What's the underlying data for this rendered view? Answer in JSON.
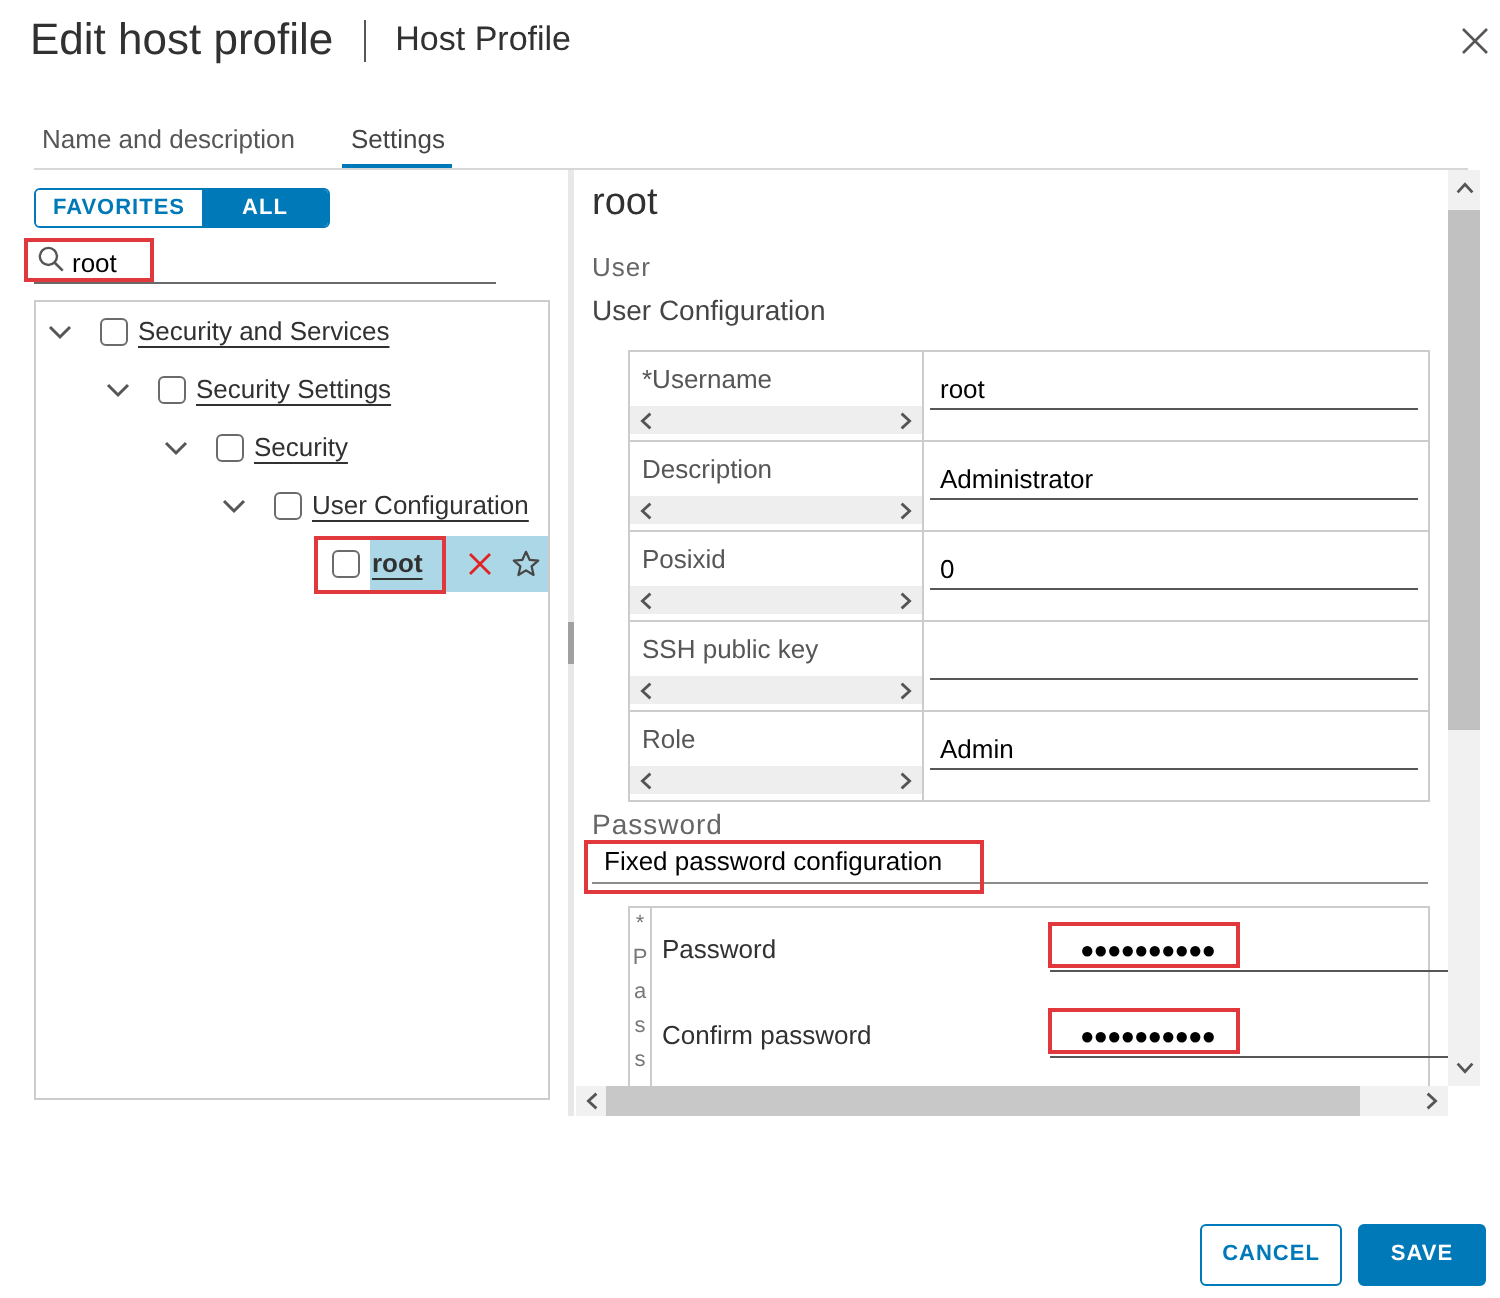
{
  "dialog": {
    "title": "Edit host profile",
    "subtitle": "Host Profile"
  },
  "tabs": [
    {
      "label": "Name and description",
      "selected": false
    },
    {
      "label": "Settings",
      "selected": true
    }
  ],
  "filter_toggle": [
    {
      "label": "FAVORITES",
      "selected": false
    },
    {
      "label": "ALL",
      "selected": true
    }
  ],
  "search": {
    "value": "root",
    "annotated": true
  },
  "tree": [
    {
      "label": "Security and Services",
      "checked": false,
      "expanded": true,
      "selected": false,
      "annotated": false,
      "children": [
        {
          "label": "Security Settings",
          "checked": false,
          "expanded": true,
          "selected": false,
          "annotated": false,
          "children": [
            {
              "label": "Security",
              "checked": false,
              "expanded": true,
              "selected": false,
              "annotated": false,
              "children": [
                {
                  "label": "User Configuration",
                  "checked": false,
                  "expanded": true,
                  "selected": false,
                  "annotated": false,
                  "children": [
                    {
                      "label": "root",
                      "checked": false,
                      "selected": true,
                      "annotated": true
                    }
                  ]
                }
              ]
            }
          ]
        }
      ]
    }
  ],
  "detail": {
    "title": "root",
    "section": "User",
    "subsection": "User Configuration",
    "fields": [
      {
        "label": "*Username",
        "value": "root"
      },
      {
        "label": "Description",
        "value": "Administrator"
      },
      {
        "label": "Posixid",
        "value": "0"
      },
      {
        "label": "SSH public key"
      },
      {
        "label": "Role",
        "value": "Admin"
      }
    ]
  },
  "password": {
    "label": "Password",
    "option": "Fixed password configuration",
    "option_annotated": true,
    "column_1_lines": [
      "*",
      "P",
      "a",
      "s",
      "s"
    ],
    "fields": [
      {
        "label": "Password",
        "value": "●●●●●●●●●●",
        "annotated": true
      },
      {
        "label": "Confirm password",
        "value": "●●●●●●●●●●",
        "annotated": true
      }
    ]
  },
  "buttons": [
    {
      "label": "CANCEL",
      "kind": "secondary"
    },
    {
      "label": "SAVE",
      "kind": "primary"
    }
  ]
}
